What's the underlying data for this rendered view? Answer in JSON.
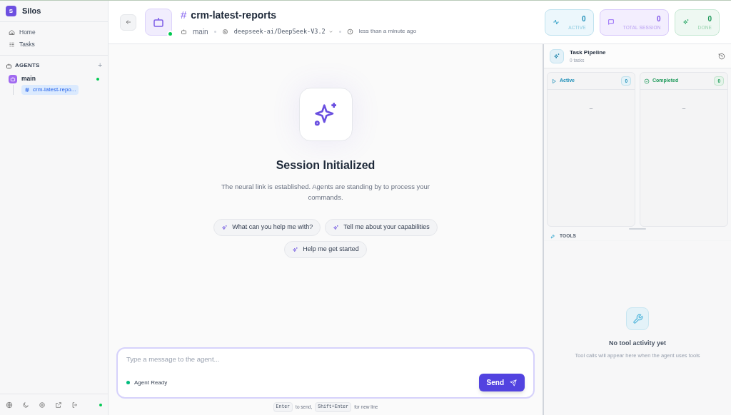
{
  "sidebar": {
    "brand": {
      "letter": "S",
      "name": "Silos"
    },
    "nav": [
      {
        "label": "Home",
        "selected": false
      },
      {
        "label": "Tasks",
        "selected": false
      }
    ],
    "agents_heading": "AGENTS",
    "add_symbol": "+",
    "agents": [
      {
        "name": "main",
        "online": true,
        "children": [
          {
            "name": "crm-latest-repo...",
            "selected": true
          }
        ]
      }
    ],
    "footer_online": true
  },
  "header": {
    "title_symbol": "#",
    "title": "crm-latest-reports",
    "agent_online": true,
    "agent": "main",
    "model": "deepseek-ai/DeepSeek-V3.2",
    "time": "less than a minute ago",
    "stats": [
      {
        "kind": "active",
        "value": "0",
        "label": "ACTIVE"
      },
      {
        "kind": "session",
        "value": "0",
        "label": "TOTAL SESSION"
      },
      {
        "kind": "done",
        "value": "0",
        "label": "DONE"
      }
    ]
  },
  "session": {
    "title": "Session Initialized",
    "text": "The neural link is established. Agents are standing by to process your commands.",
    "suggestions": [
      "What can you help me with?",
      "Tell me about your capabilities",
      "Help me get started"
    ]
  },
  "composer": {
    "placeholder": "Type a message to the agent...",
    "status": "Agent Ready",
    "ready": true,
    "send": "Send",
    "hint": [
      {
        "kind": "key",
        "text": "Enter"
      },
      {
        "kind": "text",
        "text": "to send,"
      },
      {
        "kind": "key",
        "text": "Shift+Enter"
      },
      {
        "kind": "text",
        "text": "for new line"
      }
    ]
  },
  "pipeline": {
    "title": "Task Pipeline",
    "subtitle": "0 tasks",
    "columns": [
      {
        "kind": "active",
        "label": "Active",
        "count": "0",
        "empty": "–"
      },
      {
        "kind": "completed",
        "label": "Completed",
        "count": "0",
        "empty": "–"
      }
    ]
  },
  "tools": {
    "heading": "TOOLS",
    "empty_title": "No tool activity yet",
    "empty_text": "Tool calls will appear here when the agent uses tools"
  }
}
